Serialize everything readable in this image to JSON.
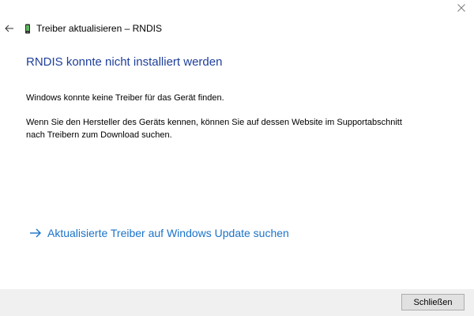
{
  "window": {
    "header_title": "Treiber aktualisieren – RNDIS"
  },
  "content": {
    "title": "RNDIS konnte nicht installiert werden",
    "message_1": "Windows konnte keine Treiber für das Gerät finden.",
    "message_2": "Wenn Sie den Hersteller des Geräts kennen, können Sie auf dessen Website im Supportabschnitt nach Treibern zum Download suchen.",
    "update_link": "Aktualisierte Treiber auf Windows Update suchen"
  },
  "footer": {
    "close_label": "Schließen"
  },
  "icons": {
    "close": "close-icon",
    "back": "back-arrow-icon",
    "device": "device-icon",
    "link_arrow": "arrow-right-icon"
  },
  "colors": {
    "title": "#1f3f9a",
    "link": "#1a73c9",
    "footer_bg": "#f0f0f0"
  }
}
